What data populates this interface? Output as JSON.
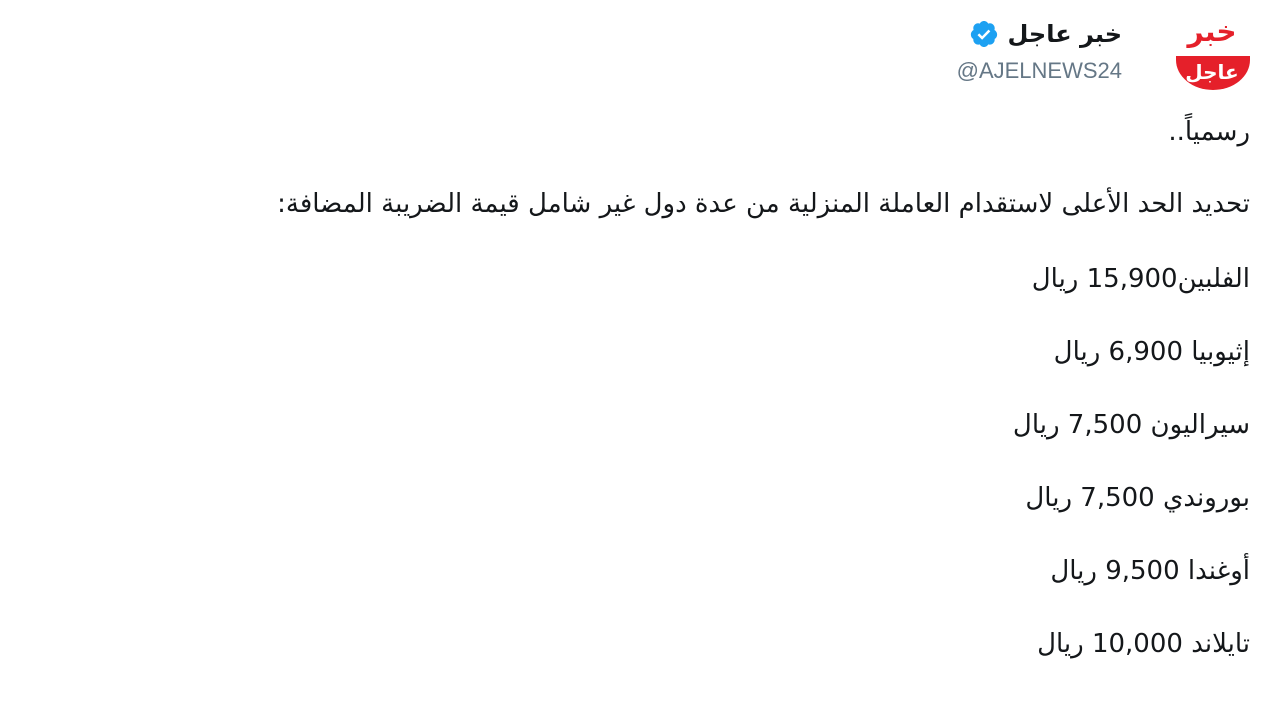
{
  "account": {
    "avatar_top": "خبر",
    "avatar_bottom": "عاجل",
    "display_name": "خبر عاجل",
    "handle": "@AJELNEWS24",
    "verified": true,
    "verified_icon": "verified-badge-icon",
    "brand_color": "#e5202a",
    "verified_color": "#1da1f2"
  },
  "tweet": {
    "intro": "رسمياً..",
    "headline": "تحديد الحد الأعلى لاستقدام العاملة المنزلية من عدة دول غير شامل قيمة الضريبة المضافة:",
    "items": [
      {
        "country": "الفلبين",
        "amount": "15,900",
        "currency": "ريال"
      },
      {
        "country": "إثيوبيا",
        "amount": "6,900",
        "currency": "ريال"
      },
      {
        "country": "سيراليون",
        "amount": "7,500",
        "currency": "ريال"
      },
      {
        "country": "بوروندي",
        "amount": "7,500",
        "currency": "ريال"
      },
      {
        "country": "أوغندا",
        "amount": "9,500",
        "currency": "ريال"
      },
      {
        "country": "تايلاند",
        "amount": "10,000",
        "currency": "ريال"
      }
    ]
  }
}
